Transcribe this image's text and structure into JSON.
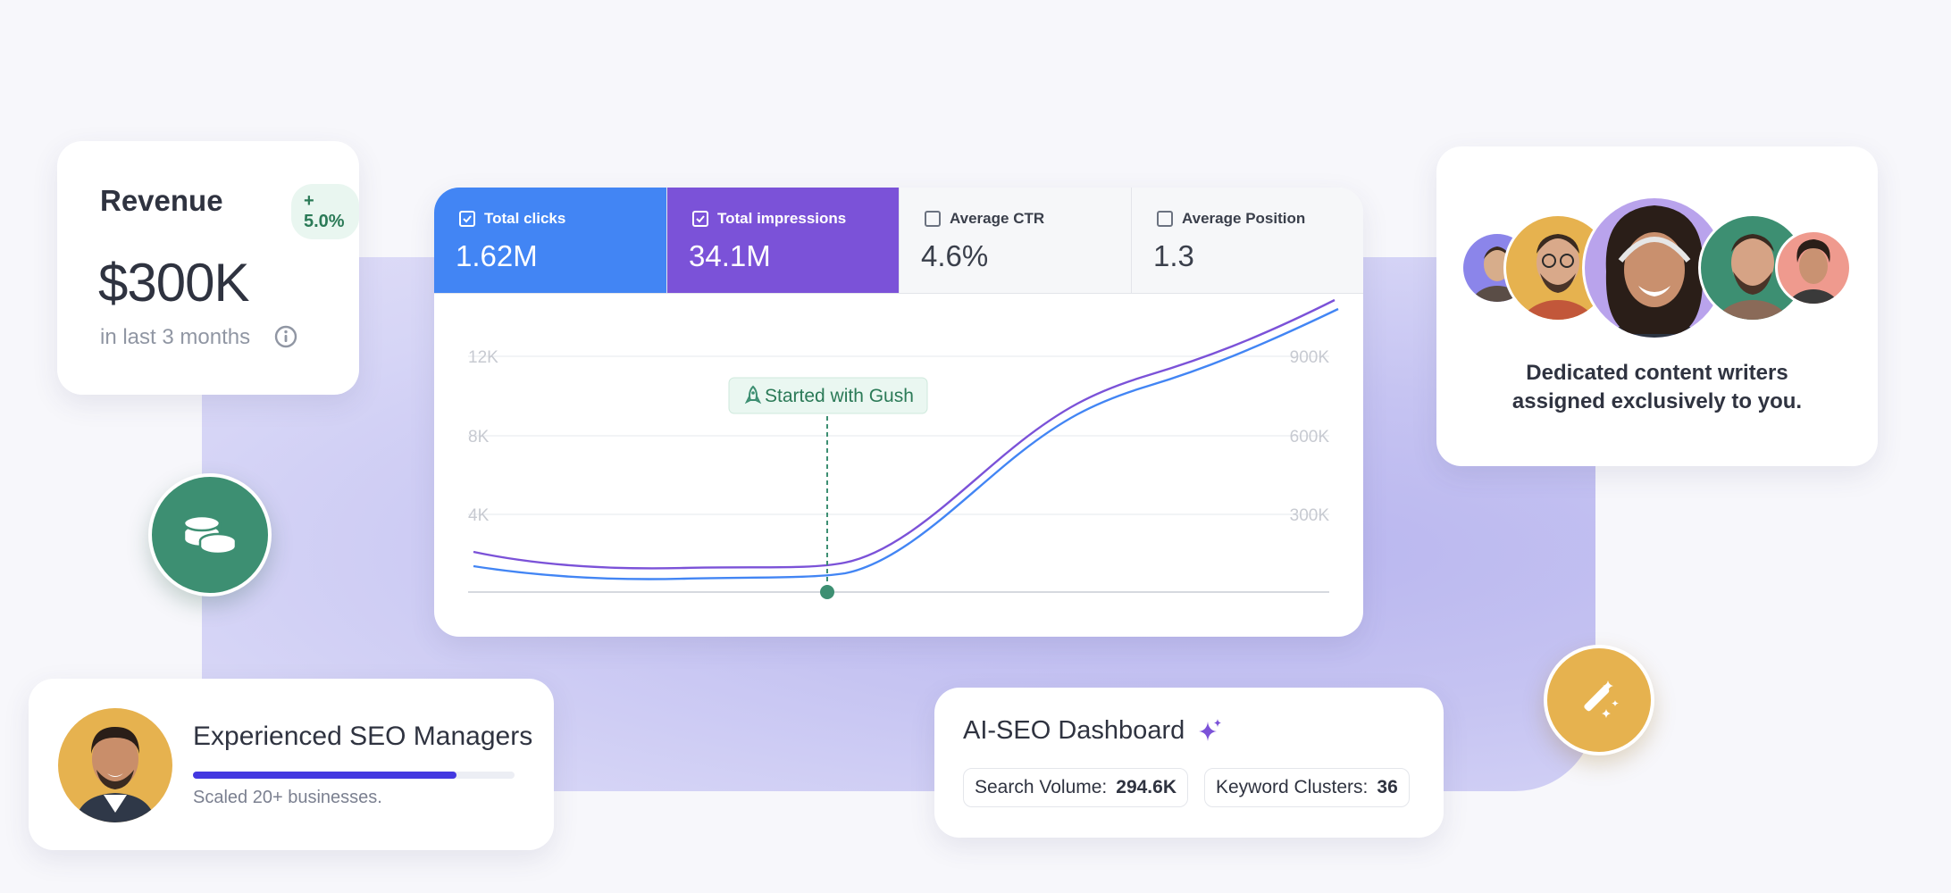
{
  "revenue": {
    "title": "Revenue",
    "badge": "+ 5.0%",
    "value": "$300K",
    "subtitle": "in last 3 months"
  },
  "metrics": [
    {
      "label": "Total clicks",
      "value": "1.62M",
      "checked": true,
      "color": "#4285f4"
    },
    {
      "label": "Total impressions",
      "value": "34.1M",
      "checked": true,
      "color": "#7b52d8"
    },
    {
      "label": "Average CTR",
      "value": "4.6%",
      "checked": false
    },
    {
      "label": "Average Position",
      "value": "1.3",
      "checked": false
    }
  ],
  "chart_data": {
    "type": "line",
    "left_axis_ticks": [
      "12K",
      "8K",
      "4K"
    ],
    "right_axis_ticks": [
      "900K",
      "600K",
      "300K"
    ],
    "annotation": "Started with Gush",
    "series": [
      {
        "name": "Total clicks",
        "color": "#4285f4"
      },
      {
        "name": "Total impressions",
        "color": "#7b52d8"
      }
    ]
  },
  "writers": {
    "text_line1": "Dedicated content writers",
    "text_line2": "assigned exclusively to you."
  },
  "managers": {
    "title": "Experienced SEO Managers",
    "progress": 0.82,
    "subtitle": "Scaled 20+ businesses."
  },
  "dashboard": {
    "title": "AI-SEO Dashboard",
    "search_volume_label": "Search Volume:",
    "search_volume_value": "294.6K",
    "keyword_clusters_label": "Keyword Clusters:",
    "keyword_clusters_value": "36"
  },
  "colors": {
    "accent_green": "#3d8f72",
    "accent_gold": "#e6b24f",
    "accent_indigo": "#4338e0"
  },
  "icons": [
    "info-icon",
    "coins-icon",
    "magic-wand-icon",
    "rocket-icon",
    "sparkle-icon",
    "checkbox-icon"
  ]
}
